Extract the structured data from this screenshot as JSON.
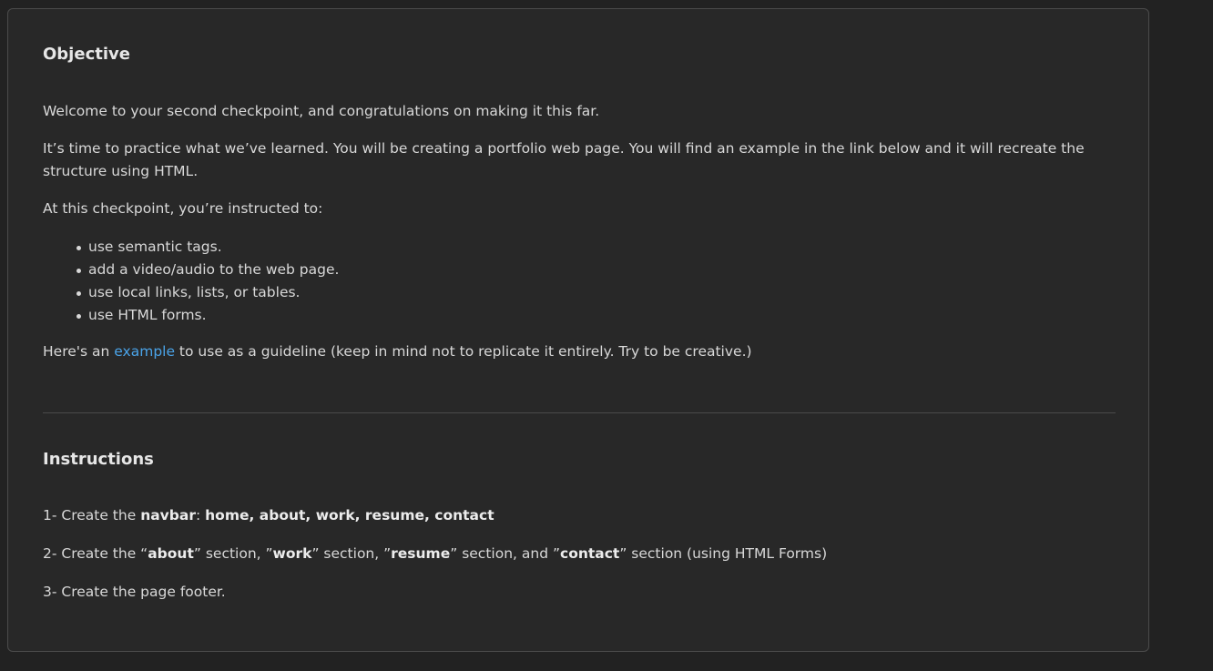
{
  "objective": {
    "heading": "Objective",
    "welcome": "Welcome to your second checkpoint, and congratulations on making it this far.",
    "practice": "It’s time to practice what we’ve learned.  You will be creating a portfolio web page. You will find an example in the link below and it will recreate the structure using HTML.",
    "instructed": "At this checkpoint, you’re instructed to:",
    "items": [
      "use semantic tags.",
      "add a video/audio to the web page.",
      "use local links, lists, or tables.",
      "use HTML forms."
    ],
    "example_prefix": "Here's an ",
    "example_link": "example",
    "example_suffix": " to use as a guideline (keep in mind not to replicate it entirely. Try to be creative.)"
  },
  "instructions": {
    "heading": "Instructions",
    "step1": {
      "prefix": "1- Create the ",
      "bold1": "navbar",
      "mid": ": ",
      "bold2": "home, about, work, resume, contact"
    },
    "step2": {
      "p1": "2- Create the “",
      "b1": "about",
      "p2": "” section, ”",
      "b2": "work",
      "p3": "” section, ”",
      "b3": "resume",
      "p4": "” section, and ”",
      "b4": "contact",
      "p5": "” section (using HTML Forms)"
    },
    "step3": "3- Create the page footer."
  }
}
